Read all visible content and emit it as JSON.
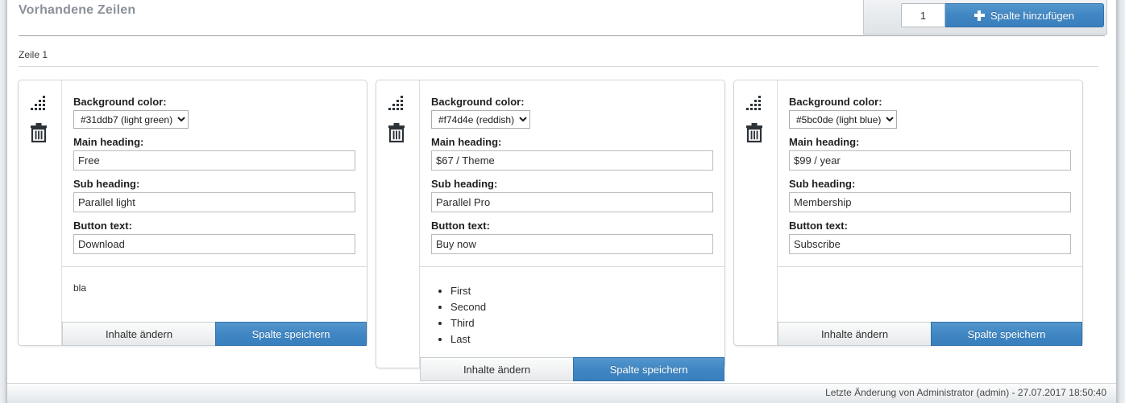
{
  "header": {
    "title": "Vorhandene Zeilen",
    "row_label": "Zeile 1",
    "toolbar": {
      "count_value": "1",
      "add_column_label": "Spalte hinzufügen",
      "plus_icon": "plus-icon"
    }
  },
  "labels": {
    "background_color": "Background color:",
    "main_heading": "Main heading:",
    "sub_heading": "Sub heading:",
    "button_text": "Button text:",
    "edit_content": "Inhalte ändern",
    "save_column": "Spalte speichern",
    "drag_icon": "drag-handle-icon",
    "delete_icon": "trash-icon"
  },
  "columns": [
    {
      "background_color": "#31ddb7 (light green)",
      "background_color_hex": "#31ddb7",
      "main_heading": "Free",
      "sub_heading": "Parallel light",
      "button_text": "Download",
      "preview_kind": "text",
      "preview_text": "bla",
      "preview_items": []
    },
    {
      "background_color": "#f74d4e (reddish)",
      "background_color_hex": "#f74d4e",
      "main_heading": "$67 / Theme",
      "sub_heading": "Parallel Pro",
      "button_text": "Buy now",
      "preview_kind": "list",
      "preview_text": "",
      "preview_items": [
        "First",
        "Second",
        "Third",
        "Last"
      ]
    },
    {
      "background_color": "#5bc0de (light blue)",
      "background_color_hex": "#5bc0de",
      "main_heading": "$99 / year",
      "sub_heading": "Membership",
      "button_text": "Subscribe",
      "preview_kind": "empty",
      "preview_text": "",
      "preview_items": []
    }
  ],
  "footer": {
    "text": "Letzte Änderung von Administrator (admin) - 27.07.2017 18:50:40"
  },
  "theme": {
    "accent": "#3f86c3",
    "title_color": "#8b9199"
  }
}
